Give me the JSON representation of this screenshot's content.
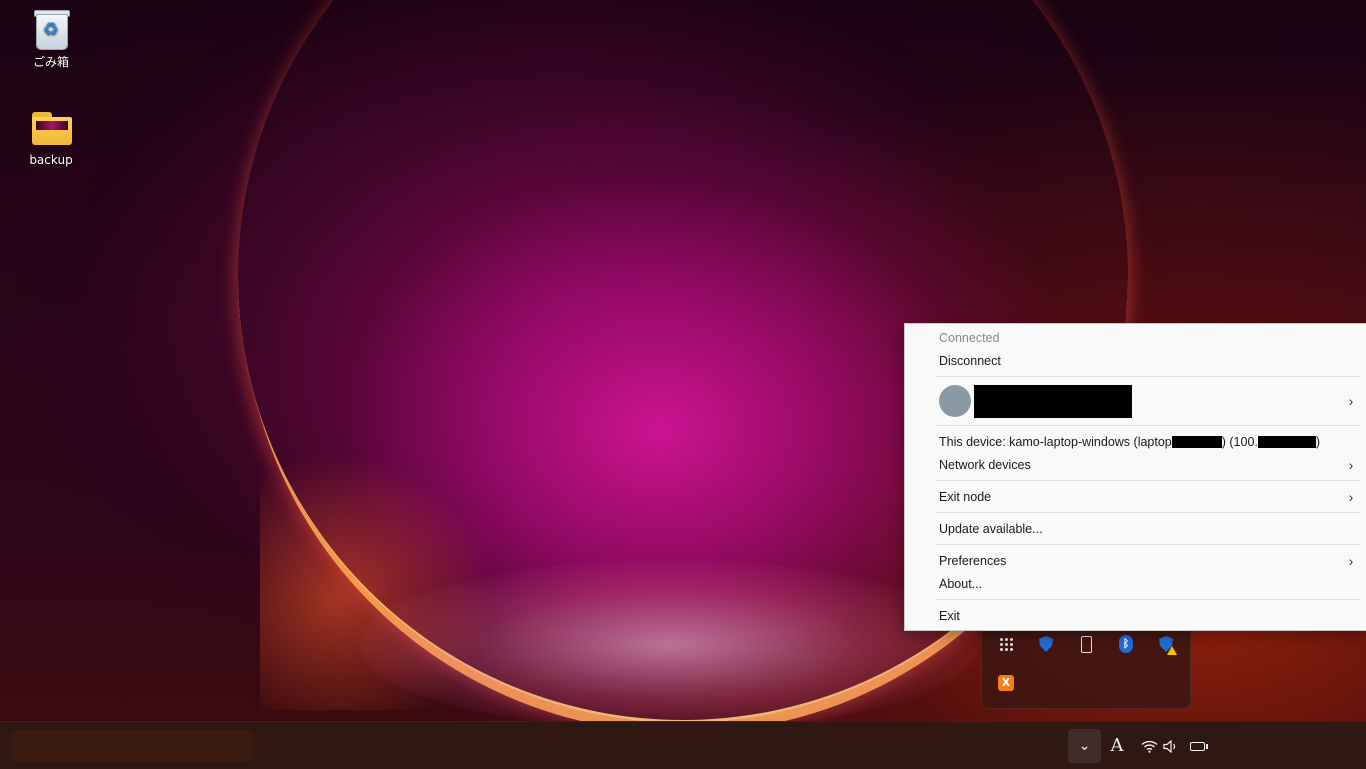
{
  "desktop": {
    "icons": [
      {
        "label": "ごみ箱"
      },
      {
        "label": "backup"
      }
    ]
  },
  "tray_overflow": {
    "icons": [
      "apps-grid-icon",
      "defender-shield-icon",
      "usb-eject-icon",
      "bluetooth-icon",
      "security-warning-shield-icon",
      "xampp-icon"
    ]
  },
  "menu": {
    "status": "Connected",
    "disconnect": "Disconnect",
    "account_chevron": "›",
    "device_prefix": "This device: kamo-laptop-windows (laptop",
    "device_mid": ") (100.",
    "device_suffix": ")",
    "network_devices": "Network devices",
    "exit_node": "Exit node",
    "update": "Update available...",
    "preferences": "Preferences",
    "about": "About...",
    "exit": "Exit",
    "chevron": "›"
  },
  "taskbar": {
    "overflow_chevron": "⌄",
    "ime_indicator": "A"
  }
}
